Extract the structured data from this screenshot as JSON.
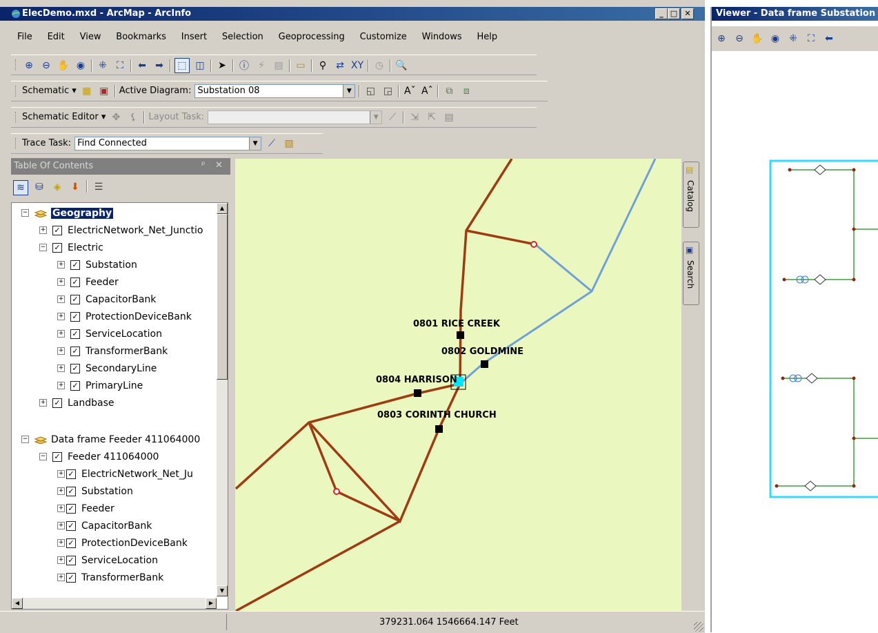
{
  "window": {
    "title": "ElecDemo.mxd - ArcMap - ArcInfo",
    "buttons": {
      "minimize": "_",
      "maximize": "□",
      "close": "✕"
    }
  },
  "menubar": [
    "File",
    "Edit",
    "View",
    "Bookmarks",
    "Insert",
    "Selection",
    "Geoprocessing",
    "Customize",
    "Windows",
    "Help"
  ],
  "toolbars": {
    "schematic": {
      "menu_label": "Schematic ▾",
      "active_diagram_label": "Active Diagram:",
      "active_diagram_value": "Substation 08"
    },
    "schematic_editor": {
      "menu_label": "Schematic Editor ▾",
      "layout_task_label": "Layout Task:",
      "layout_task_value": ""
    },
    "trace": {
      "label": "Trace Task:",
      "value": "Find Connected"
    }
  },
  "toc": {
    "title": "Table Of Contents",
    "pin": "ᵖ",
    "close": "✕",
    "rows": [
      {
        "label": "Geography",
        "pm": "−"
      },
      {
        "label": "ElectricNetwork_Net_Junctio",
        "pm": "+"
      },
      {
        "label": "Electric",
        "pm": "−"
      },
      {
        "label": "Substation",
        "pm": "+"
      },
      {
        "label": "Feeder",
        "pm": "+"
      },
      {
        "label": "CapacitorBank",
        "pm": "+"
      },
      {
        "label": "ProtectionDeviceBank",
        "pm": "+"
      },
      {
        "label": "ServiceLocation",
        "pm": "+"
      },
      {
        "label": "TransformerBank",
        "pm": "+"
      },
      {
        "label": "SecondaryLine",
        "pm": "+"
      },
      {
        "label": "PrimaryLine",
        "pm": "+"
      },
      {
        "label": "Landbase",
        "pm": "+"
      },
      {
        "label": "Data frame Feeder 411064000",
        "pm": "−"
      },
      {
        "label": "Feeder 411064000",
        "pm": "−"
      },
      {
        "label": "ElectricNetwork_Net_Ju",
        "pm": "+"
      },
      {
        "label": "Substation",
        "pm": "+"
      },
      {
        "label": "Feeder",
        "pm": "+"
      },
      {
        "label": "CapacitorBank",
        "pm": "+"
      },
      {
        "label": "ProtectionDeviceBank",
        "pm": "+"
      },
      {
        "label": "ServiceLocation",
        "pm": "+"
      },
      {
        "label": "TransformerBank",
        "pm": "+"
      }
    ]
  },
  "map": {
    "labels": {
      "rice_creek": "0801 RICE CREEK",
      "goldmine": "0802 GOLDMINE",
      "harrison": "0804 HARRISON",
      "corinth": "0803 CORINTH CHURCH"
    }
  },
  "side_tabs": {
    "catalog": "Catalog",
    "search": "Search"
  },
  "status": {
    "coordinates": "379231.064  1546664.147 Feet"
  },
  "viewer": {
    "title": "Viewer - Data frame Substation"
  },
  "colors": {
    "primary_line": "#a03a10",
    "secondary_line": "#6fa0d8",
    "map_bg": "#eaf8c0",
    "selection": "#00e5ff",
    "diagram_line": "#3f9a3f",
    "diagram_frame": "#33d9ff"
  }
}
